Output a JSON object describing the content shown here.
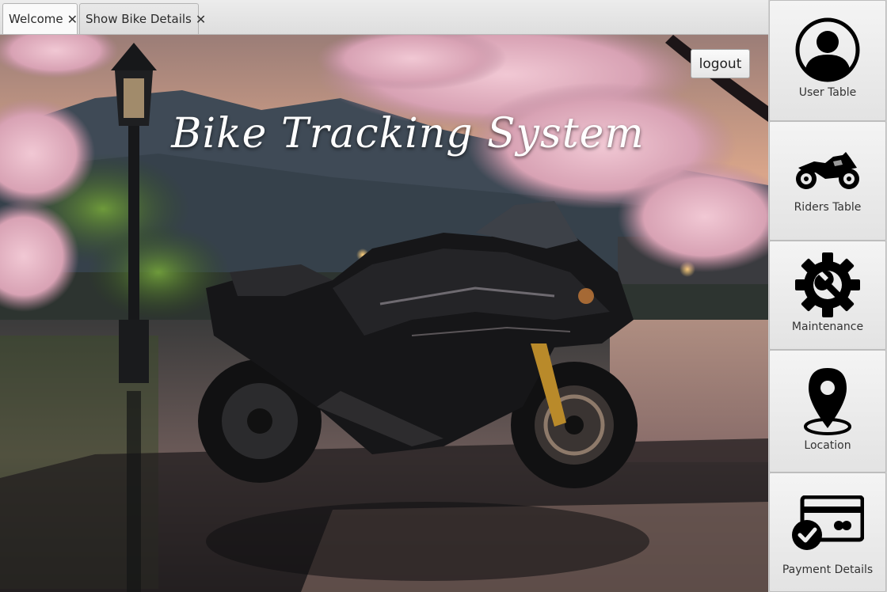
{
  "tabs": [
    {
      "label": "Welcome",
      "close": "✕",
      "active": true
    },
    {
      "label": "Show Bike Details",
      "close": "✕",
      "active": false
    }
  ],
  "main": {
    "title": "Bike Tracking System",
    "logout_label": "logout",
    "background": "photo-motorcycle-lakeside-cherry-blossoms"
  },
  "sidebar": {
    "items": [
      {
        "label": "User Table",
        "icon": "user-icon"
      },
      {
        "label": "Riders Table",
        "icon": "motorcycle-icon"
      },
      {
        "label": "Maintenance",
        "icon": "gear-wrench-icon"
      },
      {
        "label": "Location",
        "icon": "location-pin-icon"
      },
      {
        "label": "Payment Details",
        "icon": "payment-card-icon"
      }
    ]
  },
  "colors": {
    "sky_top": "#b98f7d",
    "blossom": "#e9b7c6",
    "title_text": "#ffffff",
    "icon": "#000000"
  }
}
